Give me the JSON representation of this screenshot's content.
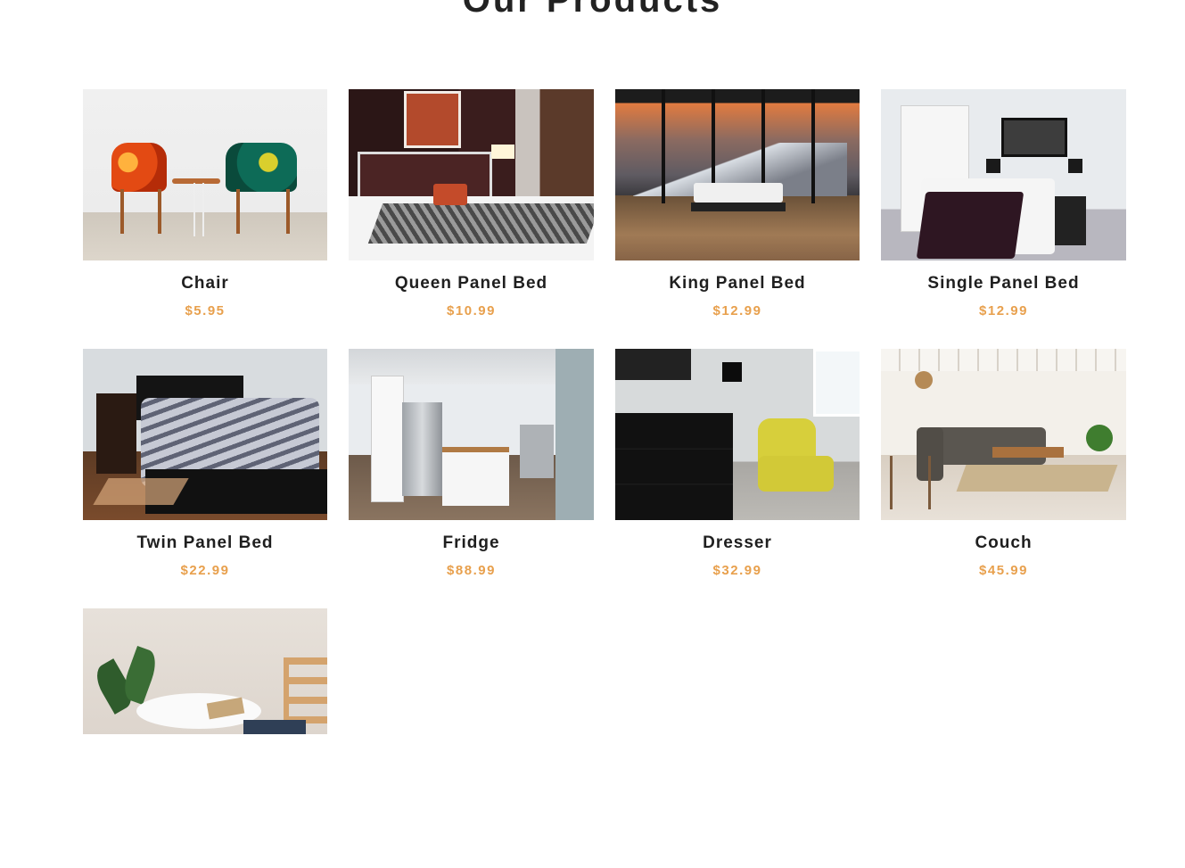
{
  "section": {
    "title": "Our Products"
  },
  "products": [
    {
      "name": "Chair",
      "price": "$5.95"
    },
    {
      "name": "Queen Panel Bed",
      "price": "$10.99"
    },
    {
      "name": "King Panel Bed",
      "price": "$12.99"
    },
    {
      "name": "Single Panel Bed",
      "price": "$12.99"
    },
    {
      "name": "Twin Panel Bed",
      "price": "$22.99"
    },
    {
      "name": "Fridge",
      "price": "$88.99"
    },
    {
      "name": "Dresser",
      "price": "$32.99"
    },
    {
      "name": "Couch",
      "price": "$45.99"
    },
    {
      "name": "",
      "price": ""
    }
  ],
  "colors": {
    "price": "#e8a04d",
    "title": "#222222"
  }
}
